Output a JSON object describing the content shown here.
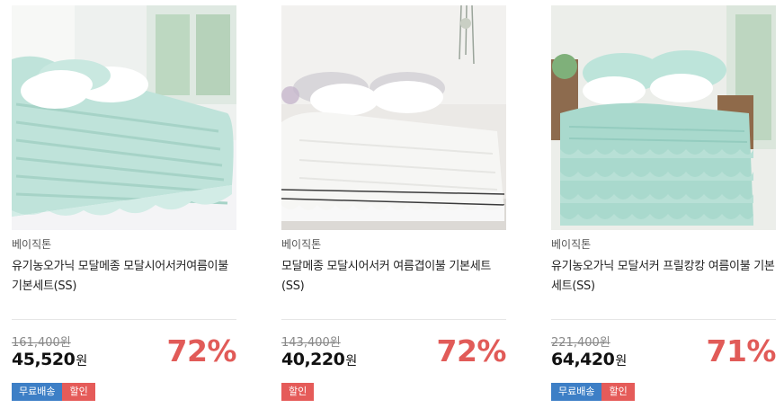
{
  "products": [
    {
      "image_alt": "mint quilted bedding with ruffle pillows",
      "brand": "베이직톤",
      "title": "유기농오가닉 모달메종 모달시어서커여름이불 기본세트(SS)",
      "original_price": "161,400원",
      "price": "45,520",
      "currency": "원",
      "discount": "72%",
      "badges": {
        "free_shipping": "무료배송",
        "sale": "할인"
      },
      "colors": {
        "bed": "#bfe3da",
        "pillow": "#ffffff",
        "wall": "#eef1ef",
        "skirt": "#f4f4f6"
      }
    },
    {
      "image_alt": "white seersucker bedding with ruffle skirt",
      "brand": "베이직톤",
      "title": "모달메종 모달시어서커 여름겹이불 기본세트(SS)",
      "original_price": "143,400원",
      "price": "40,220",
      "currency": "원",
      "discount": "72%",
      "badges": {
        "sale": "할인"
      },
      "colors": {
        "bed": "#f6f6f4",
        "pillow": "#ffffff",
        "wall": "#ebe9e6",
        "skirt": "#f8f8f8"
      }
    },
    {
      "image_alt": "mint frill cancan bedding",
      "brand": "베이직톤",
      "title": "유기농오가닉 모달서커 프릴캉캉 여름이불 기본세트(SS)",
      "original_price": "221,400원",
      "price": "64,420",
      "currency": "원",
      "discount": "71%",
      "badges": {
        "free_shipping": "무료배송",
        "sale": "할인"
      },
      "colors": {
        "bed": "#a9d9cd",
        "pillow": "#ffffff",
        "wall": "#eceeea",
        "skirt": "#b8e0d6"
      }
    }
  ]
}
